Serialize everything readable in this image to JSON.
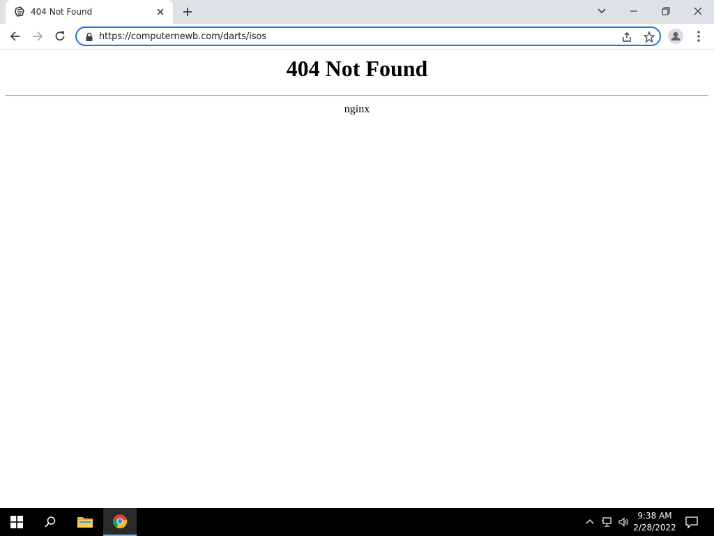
{
  "browser": {
    "tab": {
      "title": "404 Not Found",
      "favicon": "darts-icon"
    },
    "address": {
      "url": "https://computernewb.com/darts/isos"
    },
    "icons": [
      "back-icon",
      "forward-icon",
      "reload-icon",
      "lock-icon",
      "share-icon",
      "star-icon",
      "profile-icon",
      "menu-icon"
    ]
  },
  "page": {
    "heading": "404 Not Found",
    "server": "nginx"
  },
  "taskbar": {
    "apps": [
      "start-icon",
      "search-icon",
      "file-explorer-icon",
      "chrome-icon"
    ],
    "clock": {
      "time": "9:38 AM",
      "date": "2/28/2022"
    }
  },
  "colors": {
    "accent": "#1a73e8",
    "tabstrip": "#dee1e6",
    "taskbar": "#000000"
  }
}
